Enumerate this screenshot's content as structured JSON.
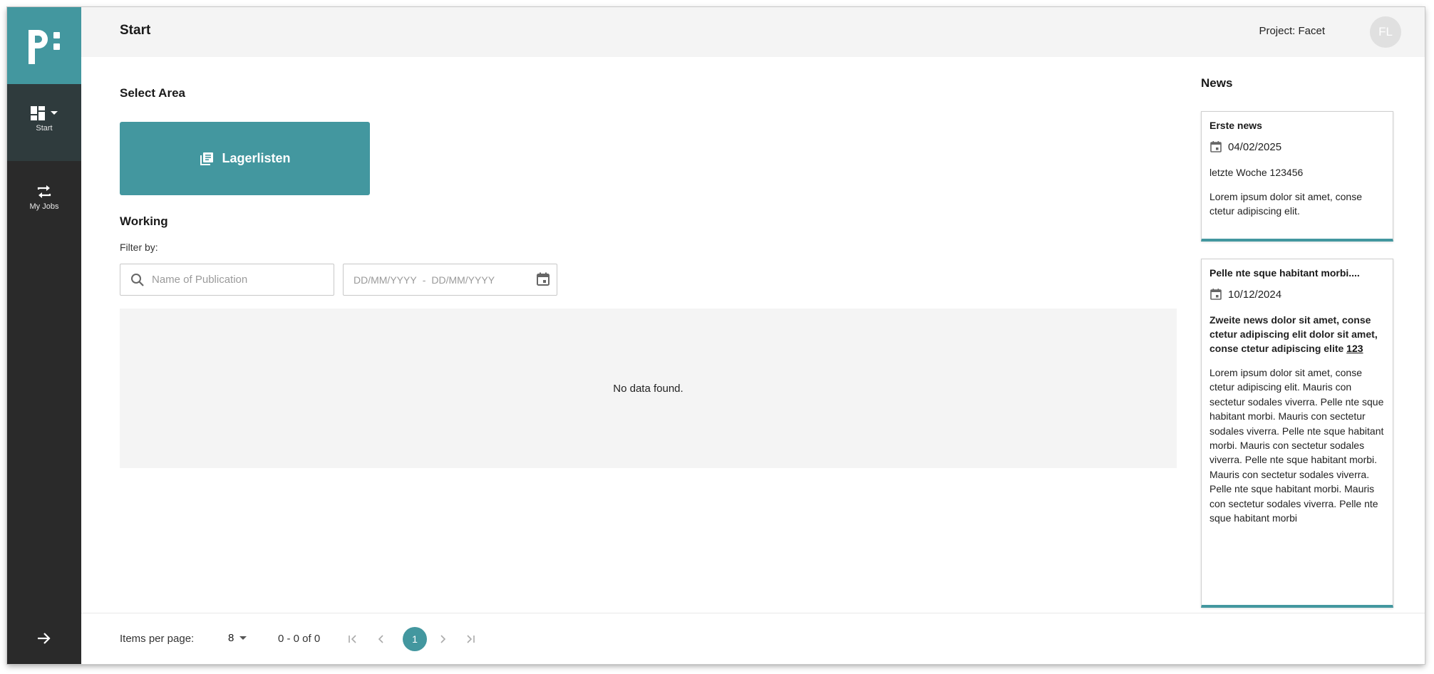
{
  "sidebar": {
    "logo_icon": "pspace-logo-icon",
    "items": [
      {
        "label": "Start",
        "icon": "dashboard-icon"
      },
      {
        "label": "My Jobs",
        "icon": "swap-arrows-icon"
      }
    ],
    "expand_icon": "arrow-right-icon"
  },
  "header": {
    "title": "Start",
    "project": "Project: Facet",
    "avatar_initials": "FL"
  },
  "main": {
    "select_area_title": "Select Area",
    "area_button_label": "Lagerlisten",
    "working_title": "Working",
    "filter_label": "Filter by:",
    "search_placeholder": "Name of Publication",
    "date_start_placeholder": "DD/MM/YYYY",
    "date_separator": "-",
    "date_end_placeholder": "DD/MM/YYYY",
    "empty_message": "No data found."
  },
  "paginator": {
    "items_per_page_label": "Items per page:",
    "items_per_page_value": "8",
    "range_label": "0 - 0 of 0",
    "current_page": "1"
  },
  "news": {
    "title": "News",
    "cards": [
      {
        "title": "Erste news",
        "date": "04/02/2025",
        "subtitle": "letzte Woche 123456",
        "body": "Lorem ipsum dolor sit amet, conse ctetur adipiscing elit."
      },
      {
        "title": "Pelle nte sque habitant morbi....",
        "date": "10/12/2024",
        "subtitle": "Zweite news dolor sit amet, conse ctetur adipiscing elit dolor sit amet, conse ctetur adipiscing elite",
        "subtitle_link": "123",
        "body": "Lorem ipsum dolor sit amet, conse ctetur adipiscing elit. Mauris con sectetur sodales viverra. Pelle nte sque habitant morbi. Mauris con sectetur sodales viverra. Pelle nte sque habitant morbi. Mauris con sectetur sodales viverra. Pelle nte sque habitant morbi. Mauris con sectetur sodales viverra. Pelle nte sque habitant morbi. Mauris con sectetur sodales viverra. Pelle nte sque habitant morbi"
      }
    ]
  },
  "colors": {
    "accent": "#43979f",
    "sidebar_bg": "#2a2a2a",
    "sidebar_active_bg": "#2f3b3d",
    "header_bg": "#f4f4f4"
  }
}
